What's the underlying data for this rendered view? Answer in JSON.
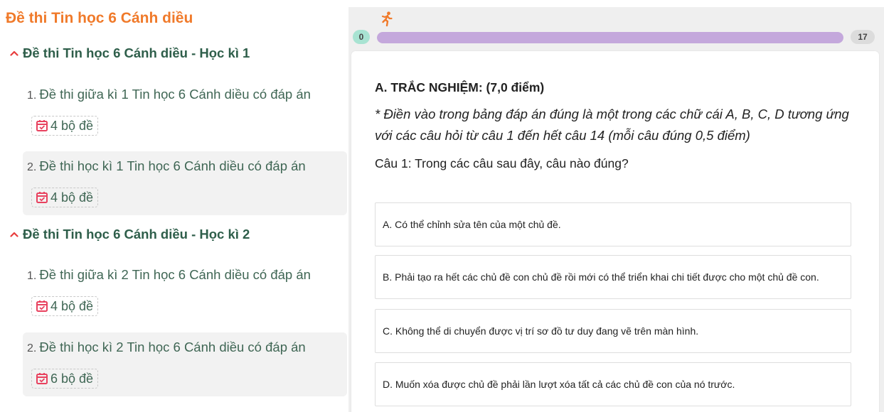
{
  "sidebar": {
    "title": "Đề thi Tin học 6 Cánh diều",
    "sections": [
      {
        "title": "Đề thi Tin học 6 Cánh diều - Học kì 1",
        "items": [
          {
            "num": "1.",
            "title": "Đề thi giữa kì 1 Tin học 6 Cánh diều có đáp án",
            "badge": "4 bộ đề"
          },
          {
            "num": "2.",
            "title": "Đề thi học kì 1 Tin học 6 Cánh diều có đáp án",
            "badge": "4 bộ đề"
          }
        ]
      },
      {
        "title": "Đề thi Tin học 6 Cánh diều - Học kì 2",
        "items": [
          {
            "num": "1.",
            "title": "Đề thi giữa kì 2 Tin học 6 Cánh diều có đáp án",
            "badge": "4 bộ đề"
          },
          {
            "num": "2.",
            "title": "Đề thi học kì 2 Tin học 6 Cánh diều có đáp án",
            "badge": "6 bộ đề"
          }
        ]
      }
    ]
  },
  "progress": {
    "start": "0",
    "end": "17",
    "fraction": 1.0
  },
  "quiz": {
    "section_title": "A. TRẮC NGHIỆM: (7,0 điểm)",
    "instruction": "* Điền vào trong bảng đáp án đúng là một trong các chữ cái A, B, C, D tương ứng với các câu hỏi từ câu 1 đến hết câu 14 (mỗi câu đúng 0,5 điểm)",
    "question": "Câu 1: Trong các câu sau đây, câu nào đúng?",
    "options": [
      "A. Có thể chỉnh sửa tên của một chủ đề.",
      "B. Phải tạo ra hết các chủ đề con chủ đề rồi mới có thể triển khai chi tiết được cho một chủ đề con.",
      "C. Không thể di chuyển được vị trí sơ đồ tư duy đang vẽ trên màn hình.",
      "D. Muốn xóa được chủ đề phải lần lượt xóa tất cả các chủ đề con của nó trước."
    ]
  },
  "colors": {
    "title_orange": "#f07a2a",
    "text_green": "#3f6654",
    "progress_fill": "#c4a8dc",
    "runner": "#f07a2a",
    "calendar_icon": "#e8425f"
  },
  "icons": {
    "section_toggle": "caret-up-icon",
    "badge": "calendar-check-icon",
    "progress": "running-person-icon"
  }
}
